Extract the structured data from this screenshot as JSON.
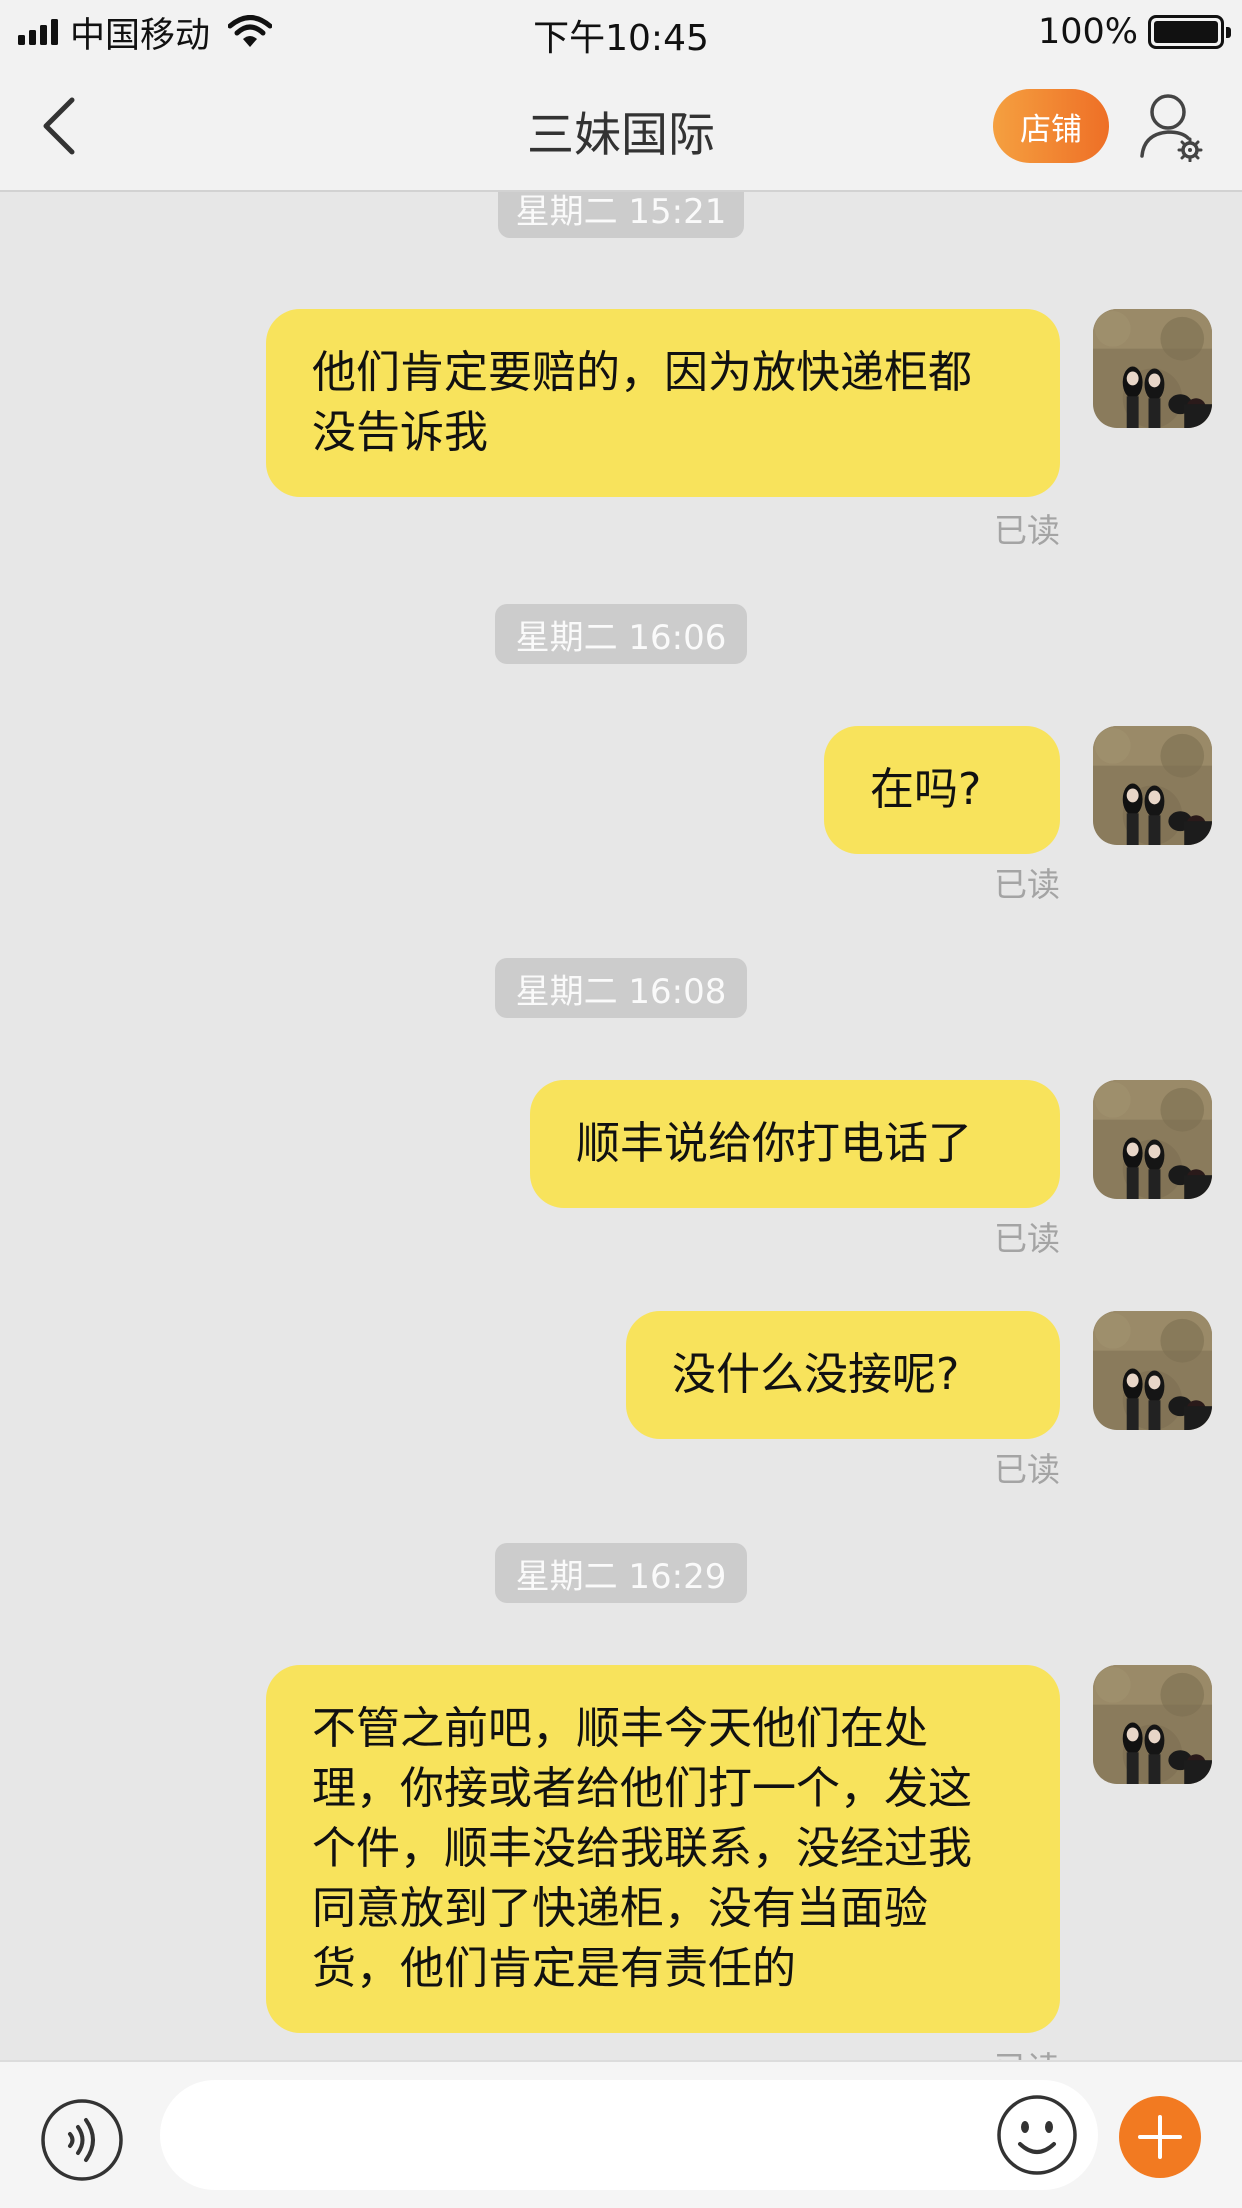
{
  "status_bar": {
    "carrier": "中国移动",
    "time": "下午10:45",
    "battery_percent": "100%",
    "icons": [
      "signal-icon",
      "wifi-icon",
      "battery-icon"
    ]
  },
  "nav": {
    "title": "三妹国际",
    "store_label": "店铺",
    "icons": [
      "back-chevron-icon",
      "user-settings-icon"
    ],
    "accent_color": "#ee6f26"
  },
  "chat": {
    "bubble_color": "#f8e35c",
    "items": [
      {
        "type": "timestamp",
        "text": "星期二 15:21"
      },
      {
        "type": "message",
        "text": "他们肯定要赔的，因为放快递柜都没告诉我",
        "status": "已读"
      },
      {
        "type": "timestamp",
        "text": "星期二 16:06"
      },
      {
        "type": "message",
        "text": "在吗?",
        "status": "已读"
      },
      {
        "type": "timestamp",
        "text": "星期二 16:08"
      },
      {
        "type": "message",
        "text": "顺丰说给你打电话了",
        "status": "已读"
      },
      {
        "type": "message",
        "text": "没什么没接呢?",
        "status": "已读"
      },
      {
        "type": "timestamp",
        "text": "星期二 16:29"
      },
      {
        "type": "message",
        "text": "不管之前吧，顺丰今天他们在处理，你接或者给他们打一个，发这个件，顺丰没给我联系，没经过我同意放到了快递柜，没有当面验货，他们肯定是有责任的",
        "status": "已读"
      }
    ]
  },
  "input_bar": {
    "value": "",
    "icons": [
      "voice-icon",
      "emoji-icon",
      "plus-icon"
    ],
    "plus_color": "#f27a21"
  }
}
